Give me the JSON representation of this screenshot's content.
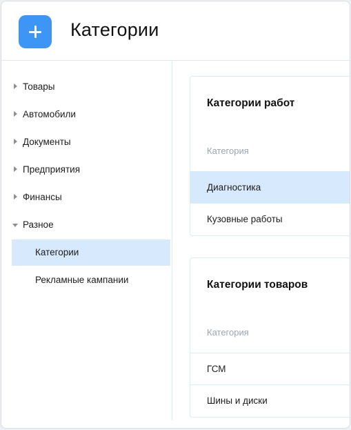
{
  "header": {
    "title": "Категории",
    "add_icon": "plus-icon",
    "accent": "#3d96f5"
  },
  "sidebar": {
    "items": [
      {
        "label": "Товары",
        "expanded": false
      },
      {
        "label": "Автомобили",
        "expanded": false
      },
      {
        "label": "Документы",
        "expanded": false
      },
      {
        "label": "Предприятия",
        "expanded": false
      },
      {
        "label": "Финансы",
        "expanded": false
      },
      {
        "label": "Разное",
        "expanded": true
      }
    ],
    "subitems": [
      {
        "label": "Категории",
        "active": true
      },
      {
        "label": "Рекламные кампании",
        "active": false
      }
    ],
    "active_bg": "#d7e9fd"
  },
  "cards": [
    {
      "title": "Категории работ",
      "column": "Категория",
      "rows": [
        {
          "label": "Диагностика",
          "selected": true
        },
        {
          "label": "Кузовные работы",
          "selected": false
        }
      ]
    },
    {
      "title": "Категории товаров",
      "column": "Категория",
      "rows": [
        {
          "label": "ГСМ",
          "selected": false
        },
        {
          "label": "Шины и диски",
          "selected": false
        }
      ]
    }
  ]
}
